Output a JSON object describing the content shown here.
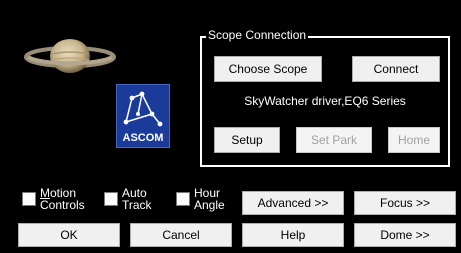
{
  "scope_connection": {
    "title": "Scope Connection",
    "choose_scope": "Choose Scope",
    "connect": "Connect",
    "driver": "SkyWatcher driver,EQ6 Series",
    "setup": "Setup",
    "set_park": "Set Park",
    "home": "Home"
  },
  "logo": {
    "text": "ASCOM",
    "icon": "ascom-constellation-logo"
  },
  "planet": {
    "icon": "saturn-image"
  },
  "checkboxes": [
    {
      "label": "Motion\nControls",
      "checked": false
    },
    {
      "label": "Auto\nTrack",
      "checked": false
    },
    {
      "label": "Hour\nAngle",
      "checked": false
    }
  ],
  "buttons": {
    "advanced": "Advanced >>",
    "focus": "Focus >>",
    "ok": "OK",
    "cancel": "Cancel",
    "help": "Help",
    "dome": "Dome >>"
  },
  "colors": {
    "background": "#000000",
    "logo_blue": "#1a3b9a",
    "saturn_tan": "#c9b68e"
  }
}
